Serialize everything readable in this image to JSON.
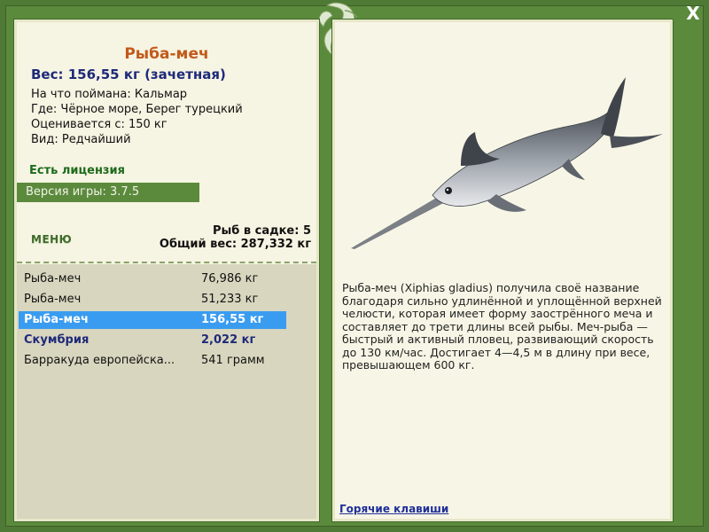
{
  "fish": {
    "title": "Рыба-меч",
    "weight": "Вес: 156,55 кг (зачетная)",
    "caught_with": "На что поймана: Кальмар",
    "location": "Где: Чёрное море, Берег турецкий",
    "rated_from": "Оценивается с: 150 кг",
    "kind": "Вид: Редчайший",
    "description": "Рыба-меч (Xiphias gladius) получила своё название благодаря сильно удлинённой и уплощённой верхней челюсти, которая имеет форму заострённого меча и составляет до трети длины всей рыбы. Меч-рыба — быстрый и активный пловец, развивающий скорость до 130 км/час. Достигает 4—4,5 м в длину при весе, превышающем 600 кг."
  },
  "license": "Есть лицензия",
  "version": "Версия игры: 3.7.5",
  "menu_label": "МЕНЮ",
  "stats": {
    "fish_in_cage": "Рыб в садке: 5",
    "total_weight": "Общий вес: 287,332 кг"
  },
  "catch_list": [
    {
      "name": "Рыба-меч",
      "weight": "76,986 кг",
      "state": "normal"
    },
    {
      "name": "Рыба-меч",
      "weight": "51,233 кг",
      "state": "normal"
    },
    {
      "name": "Рыба-меч",
      "weight": "156,55 кг",
      "state": "selected"
    },
    {
      "name": "Скумбрия",
      "weight": "2,022 кг",
      "state": "trophy"
    },
    {
      "name": "Барракуда европейска...",
      "weight": "541 грамм",
      "state": "normal"
    }
  ],
  "hotkeys": "Горячие клавиши",
  "close_label": "X",
  "icons": {
    "close": "close-icon",
    "emblem": "fish-emblem-icon"
  },
  "colors": {
    "frame": "#5b8a3d",
    "title": "#c25a1a",
    "selected": "#3a9cf0",
    "trophy": "#1e2a7a"
  }
}
